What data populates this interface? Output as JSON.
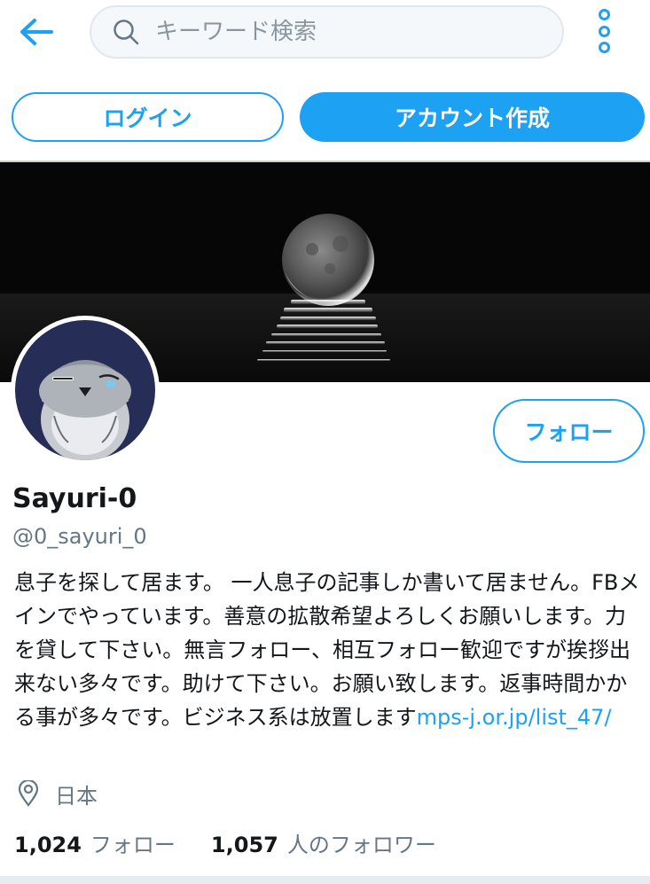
{
  "topbar": {
    "back_icon": "arrow-left-icon",
    "search_placeholder": "キーワード検索",
    "search_icon": "search-icon",
    "more_icon": "more-vertical-icon"
  },
  "auth": {
    "login_label": "ログイン",
    "signup_label": "アカウント作成"
  },
  "profile": {
    "follow_label": "フォロー",
    "name": "Sayuri-0",
    "handle": "@0_sayuri_0",
    "bio_text": "息子を探して居ます。 一人息子の記事しか書いて居ません。FBメインでやっています。善意の拡散希望よろしくお願いします。力を貸して下さい。無言フォロー、相互フォロー歓迎ですが挨拶出来ない多々です。助けて下さい。お願い致します。返事時間かかる事が多々です。ビジネス系は放置します",
    "bio_link": "mps-j.or.jp/list_47/",
    "location_icon": "location-pin-icon",
    "location": "日本",
    "following_count": "1,024",
    "following_label": "フォロー",
    "followers_count": "1,057",
    "followers_label": "人のフォロワー"
  },
  "colors": {
    "accent": "#1da1f2",
    "text": "#14171a",
    "secondary_text": "#657786",
    "avatar_bg": "#262d56"
  }
}
